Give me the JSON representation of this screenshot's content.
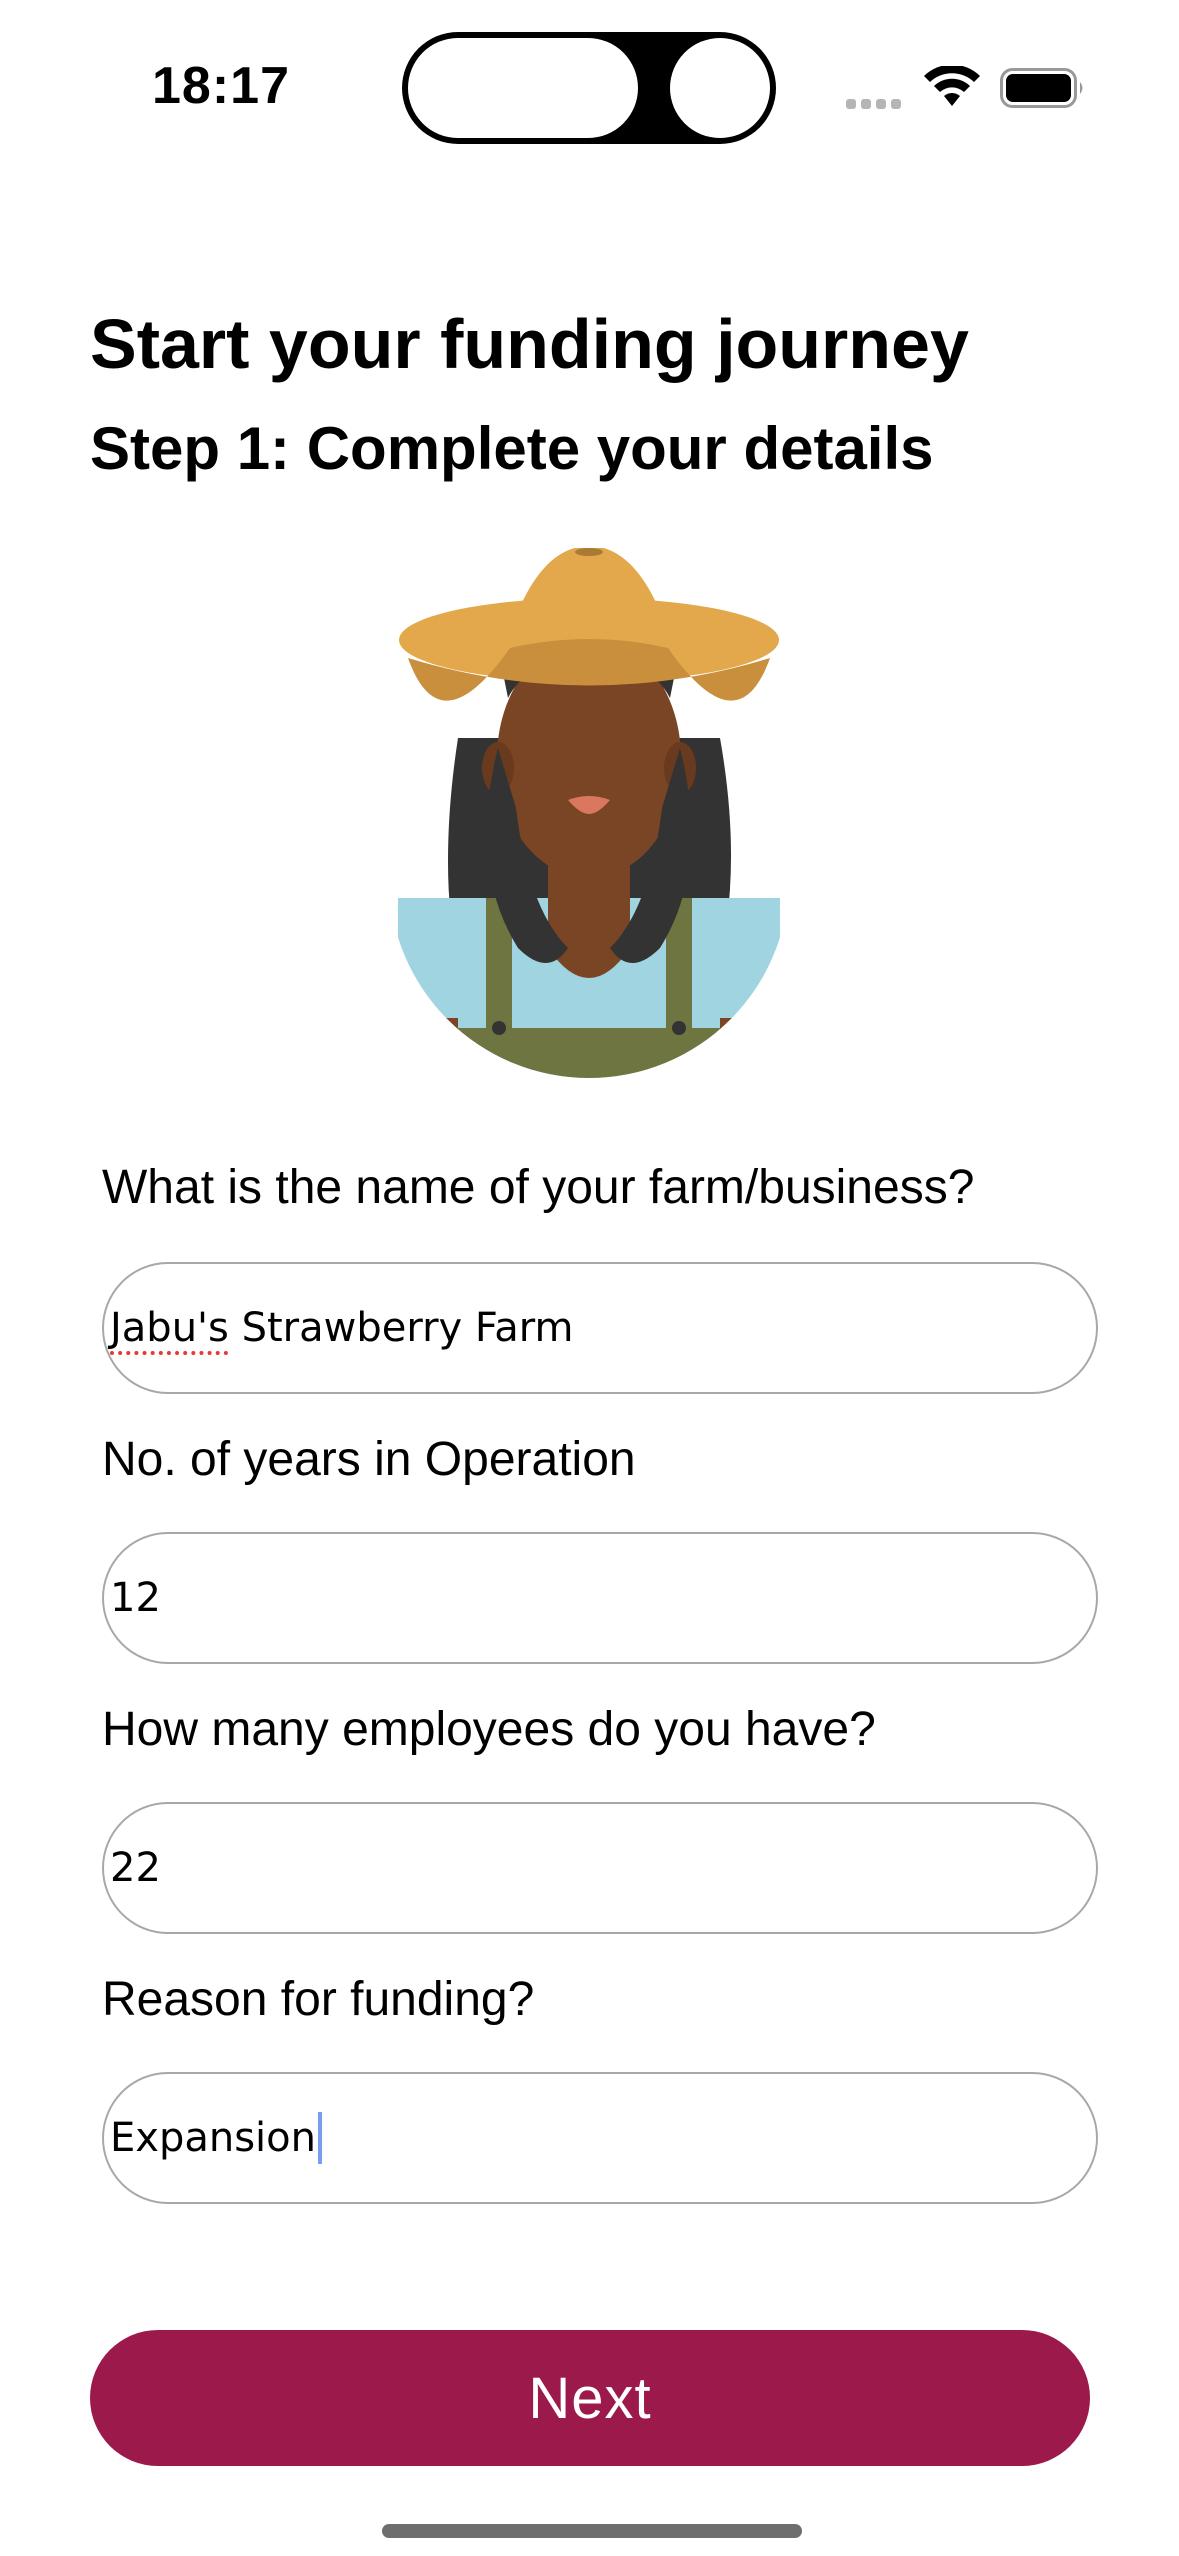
{
  "status_bar": {
    "time": "18:17"
  },
  "header": {
    "title": "Start your funding journey",
    "subtitle": "Step 1: Complete your details"
  },
  "form": {
    "farm_name": {
      "label": "What is the name of your farm/business?",
      "value_misspelled": "Jabu's",
      "value_rest": " Strawberry Farm"
    },
    "years": {
      "label": "No. of years in Operation",
      "value": "12"
    },
    "employees": {
      "label": "How many employees do you have?",
      "value": "22"
    },
    "reason": {
      "label": "Reason for funding?",
      "value": "Expansion"
    }
  },
  "actions": {
    "next_label": "Next"
  },
  "colors": {
    "accent": "#9b194b",
    "hat": "#e3a84c",
    "skin": "#7a4524",
    "shirt": "#9fd4e0",
    "overalls": "#6f7540"
  },
  "icons": [
    "wifi-icon",
    "battery-icon",
    "signal-dots-icon",
    "farmer-avatar"
  ]
}
